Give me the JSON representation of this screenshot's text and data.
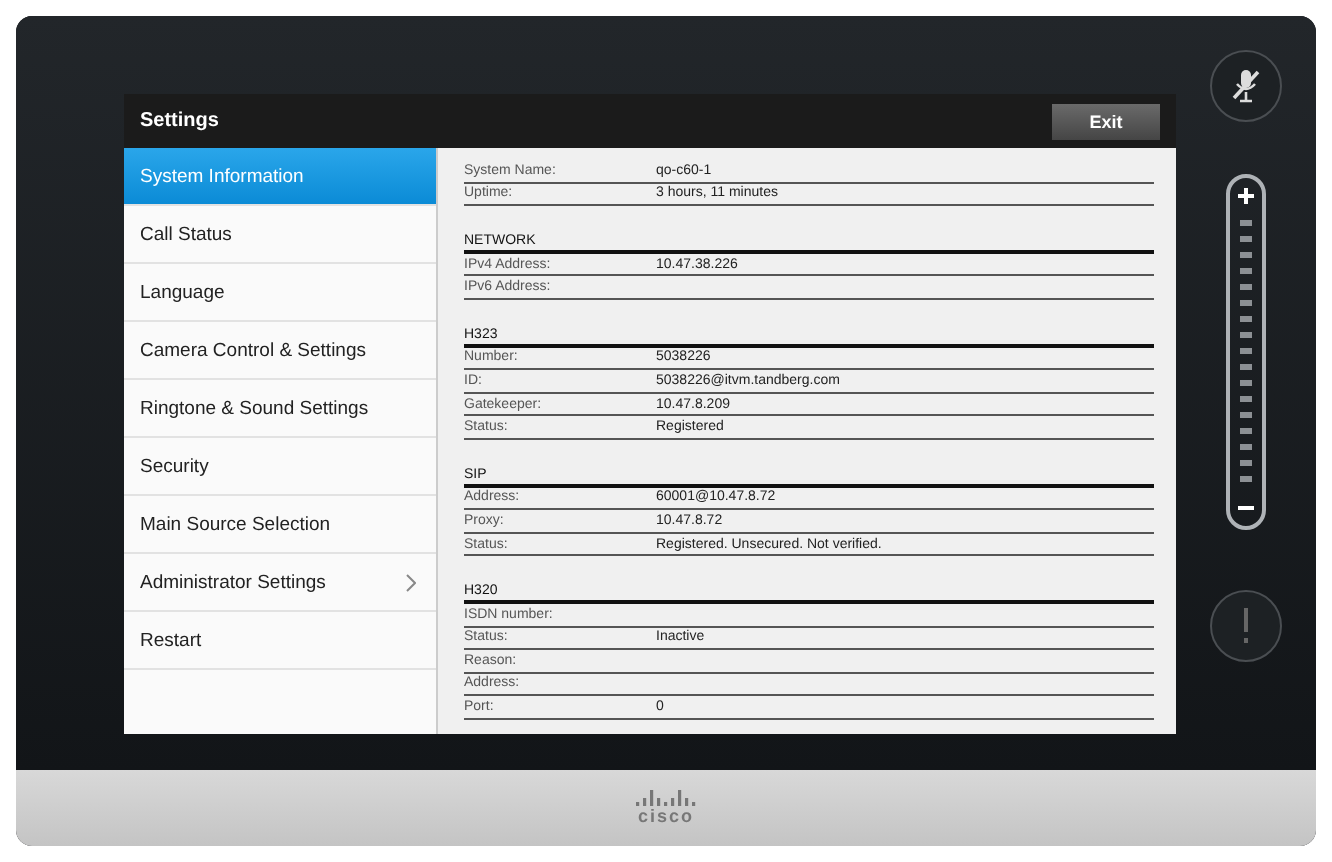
{
  "header": {
    "title": "Settings",
    "exit_button": "Exit"
  },
  "menu": [
    {
      "label": "System Information",
      "selected": true,
      "submenu": false
    },
    {
      "label": "Call Status",
      "selected": false,
      "submenu": false
    },
    {
      "label": "Language",
      "selected": false,
      "submenu": false
    },
    {
      "label": "Camera Control & Settings",
      "selected": false,
      "submenu": false
    },
    {
      "label": "Ringtone & Sound Settings",
      "selected": false,
      "submenu": false
    },
    {
      "label": "Security",
      "selected": false,
      "submenu": false
    },
    {
      "label": "Main Source Selection",
      "selected": false,
      "submenu": false
    },
    {
      "label": "Administrator Settings",
      "selected": false,
      "submenu": true
    },
    {
      "label": "Restart",
      "selected": false,
      "submenu": false
    }
  ],
  "sections": [
    {
      "rows": [
        {
          "label": "System Name:",
          "value": "qo-c60-1"
        },
        {
          "label": "Uptime:",
          "value": "3 hours, 11 minutes"
        }
      ]
    },
    {
      "heading": "NETWORK",
      "rows": [
        {
          "label": "IPv4 Address:",
          "value": "10.47.38.226"
        },
        {
          "label": "IPv6 Address:"
        }
      ]
    },
    {
      "heading": "H323",
      "rows": [
        {
          "label": "Number:",
          "value": "5038226"
        },
        {
          "label": "ID:",
          "value": "5038226@itvm.tandberg.com"
        },
        {
          "label": "Gatekeeper:",
          "value": "10.47.8.209"
        },
        {
          "label": "Status:",
          "value": "Registered"
        }
      ]
    },
    {
      "heading": "SIP",
      "rows": [
        {
          "label": "Address:",
          "value": "60001@10.47.8.72"
        },
        {
          "label": "Proxy:",
          "value": "10.47.8.72"
        },
        {
          "label": "Status:",
          "value": "Registered. Unsecured. Not verified."
        }
      ]
    },
    {
      "heading": "H320",
      "rows": [
        {
          "label": "ISDN number:"
        },
        {
          "label": "Status:",
          "value": "Inactive"
        },
        {
          "label": "Reason:"
        },
        {
          "label": "Address:"
        },
        {
          "label": "Port:",
          "value": "0"
        }
      ]
    }
  ],
  "brand": {
    "wordmark": "cisco"
  }
}
